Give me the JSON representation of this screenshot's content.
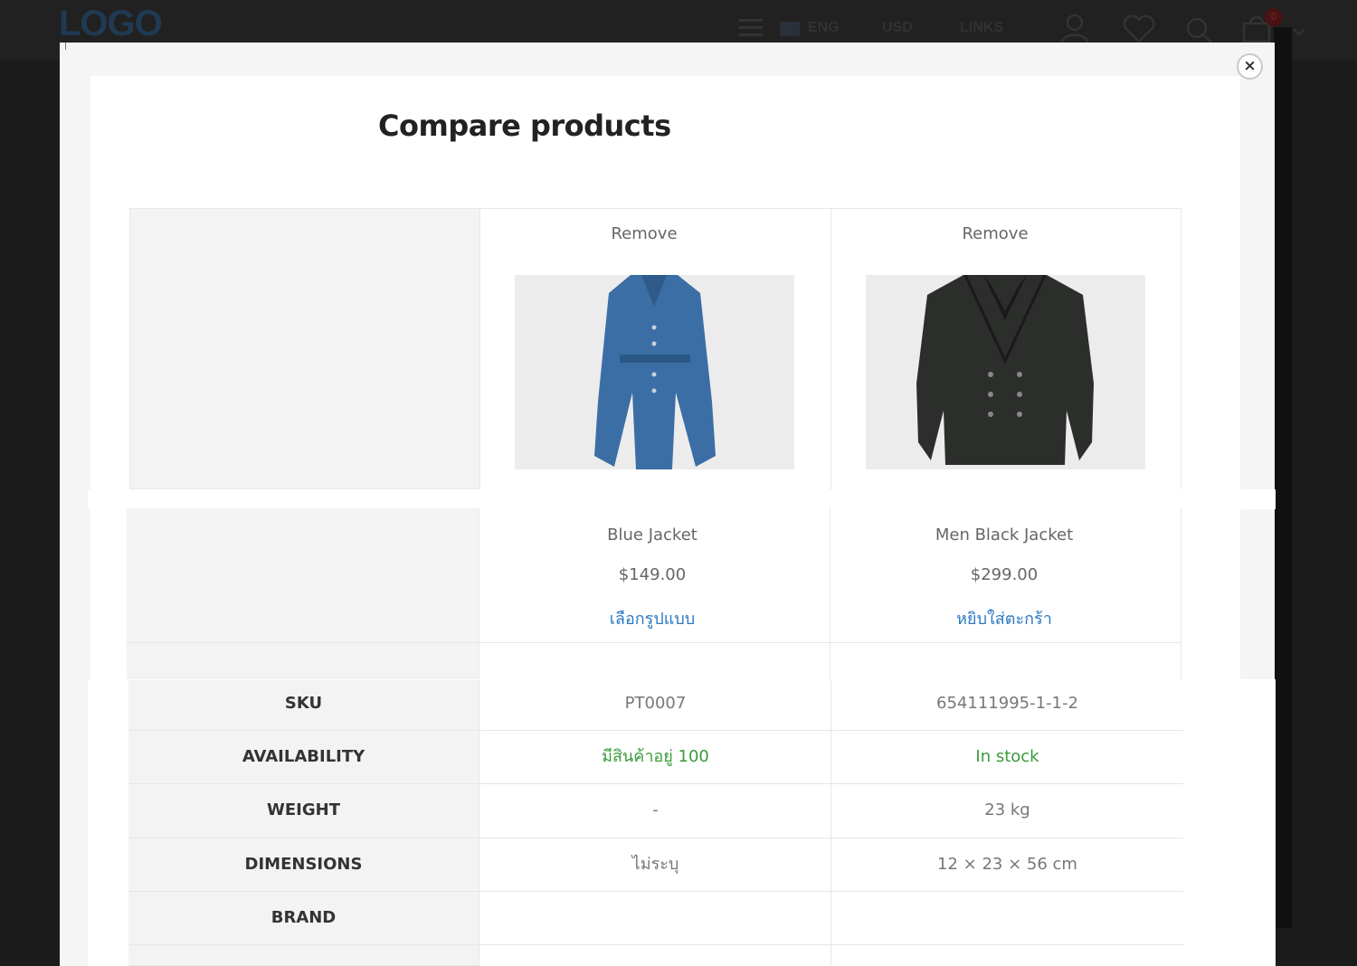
{
  "header": {
    "logo": "LOGO",
    "language": "ENG",
    "currency": "USD",
    "links": "LINKS",
    "cart_count": "0"
  },
  "modal": {
    "title": "Compare products",
    "close_label": "×"
  },
  "products": [
    {
      "remove_label": "Remove",
      "image_alt": "blue long coat",
      "name": "Blue Jacket",
      "price": "$149.00",
      "action": "เลือกรูปแบบ"
    },
    {
      "remove_label": "Remove",
      "image_alt": "black double-breasted coat",
      "name": "Men Black Jacket",
      "price": "$299.00",
      "action": "หยิบใส่ตะกร้า"
    }
  ],
  "attributes": [
    {
      "label": "SKU",
      "values": [
        "PT0007",
        "654111995-1-1-2"
      ]
    },
    {
      "label": "AVAILABILITY",
      "values": [
        "มีสินค้าอยู่ 100",
        "In stock"
      ]
    },
    {
      "label": "WEIGHT",
      "values": [
        "-",
        "23 kg"
      ]
    },
    {
      "label": "DIMENSIONS",
      "values": [
        "ไม่ระบุ",
        "12 × 23 × 56 cm"
      ]
    },
    {
      "label": "BRAND",
      "values": [
        "",
        ""
      ]
    }
  ],
  "colors": {
    "availability": "#3a9a3a",
    "link": "#2b78c2"
  }
}
